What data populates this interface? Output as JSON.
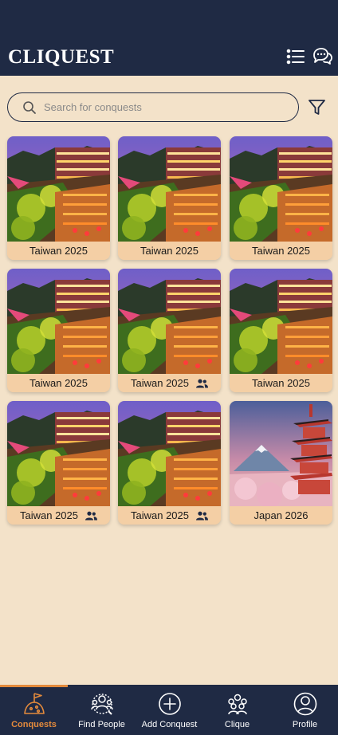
{
  "app": {
    "title": "CLIQUEST"
  },
  "header": {
    "list_icon": "list-icon",
    "chat_icon": "chat-bubbles-icon"
  },
  "search": {
    "placeholder": "Search for conquests",
    "value": ""
  },
  "conquests": [
    {
      "title": "Taiwan 2025",
      "shared": false,
      "image": "taiwan-night-town"
    },
    {
      "title": "Taiwan 2025",
      "shared": false,
      "image": "taiwan-night-town"
    },
    {
      "title": "Taiwan 2025",
      "shared": false,
      "image": "taiwan-night-town"
    },
    {
      "title": "Taiwan 2025",
      "shared": false,
      "image": "taiwan-night-town"
    },
    {
      "title": "Taiwan 2025",
      "shared": true,
      "image": "taiwan-night-town"
    },
    {
      "title": "Taiwan 2025",
      "shared": false,
      "image": "taiwan-night-town"
    },
    {
      "title": "Taiwan 2025",
      "shared": true,
      "image": "taiwan-night-town"
    },
    {
      "title": "Taiwan 2025",
      "shared": true,
      "image": "taiwan-night-town"
    },
    {
      "title": "Japan 2026",
      "shared": false,
      "image": "japan-pagoda-fuji"
    }
  ],
  "tabs": [
    {
      "label": "Conquests",
      "icon": "flag-hill-icon",
      "active": true
    },
    {
      "label": "Find People",
      "icon": "find-people-icon",
      "active": false
    },
    {
      "label": "Add Conquest",
      "icon": "plus-circle-icon",
      "active": false
    },
    {
      "label": "Clique",
      "icon": "group-icon",
      "active": false
    },
    {
      "label": "Profile",
      "icon": "profile-icon",
      "active": false
    }
  ],
  "colors": {
    "header_bg": "#1f2a44",
    "page_bg": "#f3e2c9",
    "card_caption_bg": "#f4cfa5",
    "accent": "#e38a3c"
  }
}
